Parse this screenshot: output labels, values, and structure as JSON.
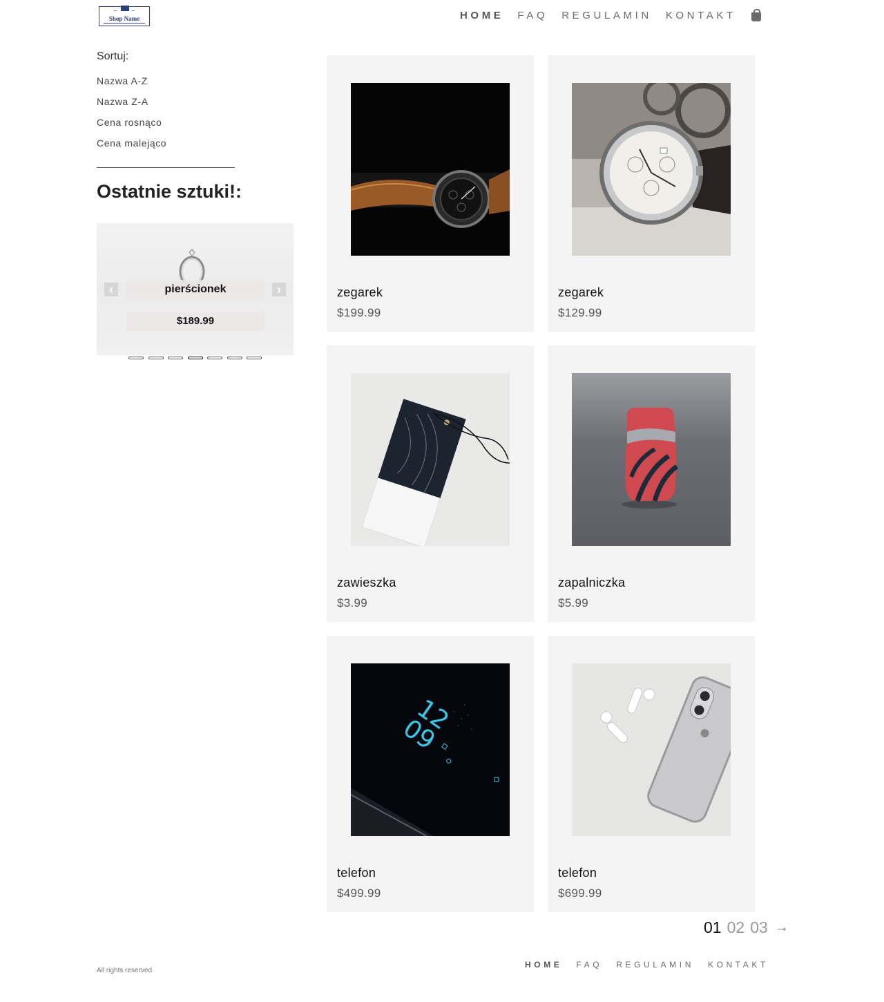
{
  "header": {
    "logo_text": "Shop Name",
    "nav": [
      {
        "label": "HOME",
        "active": true
      },
      {
        "label": "FAQ",
        "active": false
      },
      {
        "label": "REGULAMIN",
        "active": false
      },
      {
        "label": "KONTAKT",
        "active": false
      }
    ],
    "cart_icon": "shopping-bag-icon"
  },
  "sidebar": {
    "sort_title": "Sortuj:",
    "sort_options": [
      "Nazwa A-Z",
      "Nazwa Z-A",
      "Cena rosnąco",
      "Cena malejąco"
    ],
    "last_title": "Ostatnie sztuki!:",
    "slider": {
      "name": "pierścionek",
      "price": "$189.99",
      "dot_count": 7,
      "active_dot": 4
    }
  },
  "products": [
    {
      "name": "zegarek",
      "price": "$199.99",
      "image": "watch-leather-strap"
    },
    {
      "name": "zegarek",
      "price": "$129.99",
      "image": "watch-silver-dial"
    },
    {
      "name": "zawieszka",
      "price": "$3.99",
      "image": "hang-tag-mockup"
    },
    {
      "name": "zapalniczka",
      "price": "$5.99",
      "image": "red-lighter"
    },
    {
      "name": "telefon",
      "price": "$499.99",
      "image": "phone-dark-lockscreen"
    },
    {
      "name": "telefon",
      "price": "$699.99",
      "image": "iphone-with-airpods"
    }
  ],
  "pagination": {
    "pages": [
      "01",
      "02",
      "03"
    ],
    "current": "01"
  },
  "footer": {
    "copyright": "All rights reserved",
    "nav": [
      {
        "label": "HOME",
        "active": true
      },
      {
        "label": "FAQ",
        "active": false
      },
      {
        "label": "REGULAMIN",
        "active": false
      },
      {
        "label": "KONTAKT",
        "active": false
      }
    ]
  },
  "colors": {
    "card_bg": "#f4f4f4",
    "logo": "#2f3f7a",
    "nav_text": "#6a6a6a"
  }
}
